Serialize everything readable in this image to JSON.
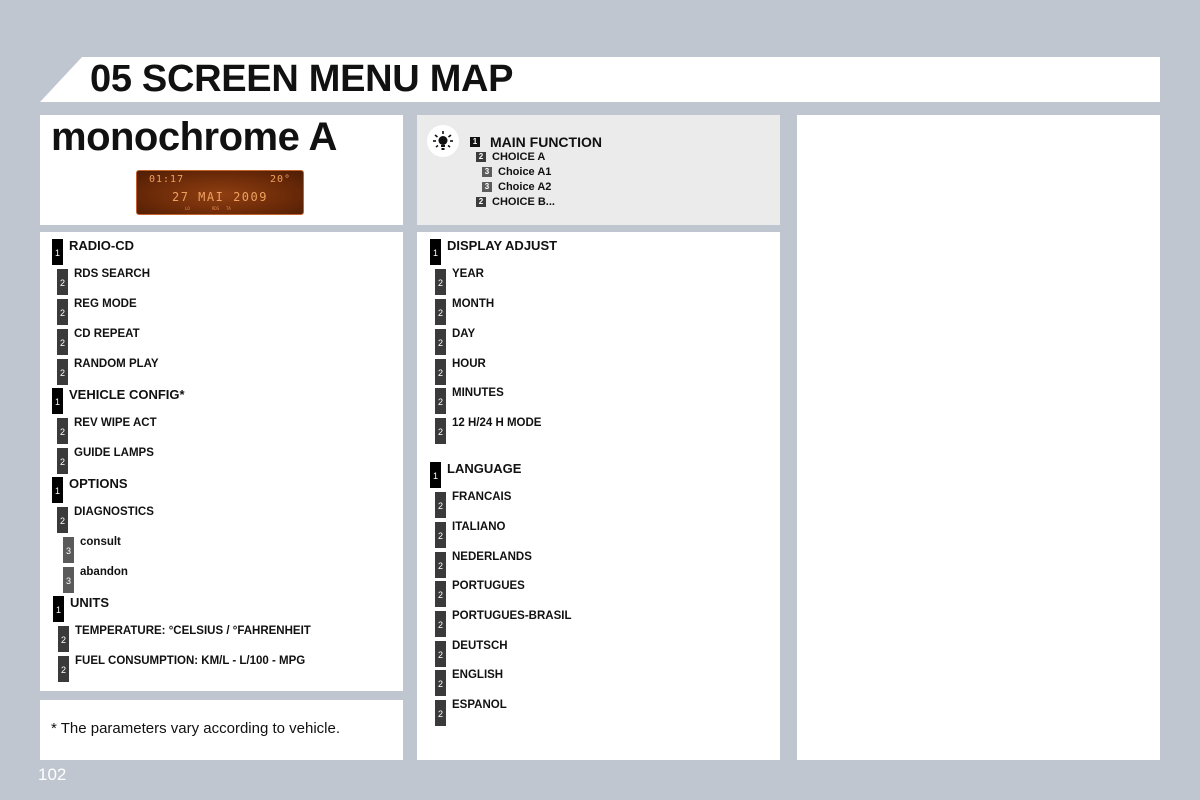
{
  "header": {
    "title": "05 SCREEN MENU MAP"
  },
  "display_panel": {
    "title": "monochrome A",
    "lcd": {
      "time": "01:17",
      "temperature": "20°",
      "date": "27 MAI 2009",
      "indicators": [
        "LO",
        "RDS",
        "TA"
      ]
    }
  },
  "legend": {
    "icon": "lightbulb-icon",
    "rows": [
      {
        "level": "1",
        "label": "MAIN FUNCTION"
      },
      {
        "level": "2",
        "label": "CHOICE A"
      },
      {
        "level": "3",
        "label": "Choice A1"
      },
      {
        "level": "3",
        "label": "Choice A2"
      },
      {
        "level": "2",
        "label": "CHOICE B..."
      }
    ]
  },
  "left_menu": [
    {
      "level": "1",
      "label": "RADIO-CD"
    },
    {
      "level": "2",
      "label": "RDS SEARCH"
    },
    {
      "level": "2",
      "label": "REG MODE"
    },
    {
      "level": "2",
      "label": "CD REPEAT"
    },
    {
      "level": "2",
      "label": "RANDOM PLAY"
    },
    {
      "level": "1",
      "label": "VEHICLE CONFIG*"
    },
    {
      "level": "2",
      "label": "REV WIPE ACT"
    },
    {
      "level": "2",
      "label": "GUIDE LAMPS"
    },
    {
      "level": "1",
      "label": "OPTIONS"
    },
    {
      "level": "2",
      "label": "DIAGNOSTICS"
    },
    {
      "level": "3",
      "label": "consult"
    },
    {
      "level": "3",
      "label": "abandon"
    },
    {
      "level": "1",
      "label": "UNITS"
    },
    {
      "level": "2",
      "label": "TEMPERATURE: °CELSIUS / °FAHRENHEIT"
    },
    {
      "level": "2",
      "label": "FUEL CONSUMPTION: KM/L - L/100 - MPG"
    }
  ],
  "middle_menu": [
    {
      "level": "1",
      "label": "DISPLAY ADJUST"
    },
    {
      "level": "2",
      "label": "YEAR"
    },
    {
      "level": "2",
      "label": "MONTH"
    },
    {
      "level": "2",
      "label": "DAY"
    },
    {
      "level": "2",
      "label": "HOUR"
    },
    {
      "level": "2",
      "label": "MINUTES"
    },
    {
      "level": "2",
      "label": "12 H/24 H MODE"
    },
    {
      "level": "1",
      "label": "LANGUAGE"
    },
    {
      "level": "2",
      "label": "FRANCAIS"
    },
    {
      "level": "2",
      "label": "ITALIANO"
    },
    {
      "level": "2",
      "label": "NEDERLANDS"
    },
    {
      "level": "2",
      "label": "PORTUGUES"
    },
    {
      "level": "2",
      "label": "PORTUGUES-BRASIL"
    },
    {
      "level": "2",
      "label": "DEUTSCH"
    },
    {
      "level": "2",
      "label": "ENGLISH"
    },
    {
      "level": "2",
      "label": "ESPANOL"
    }
  ],
  "footnote": "* The parameters vary according to vehicle.",
  "page_number": "102"
}
